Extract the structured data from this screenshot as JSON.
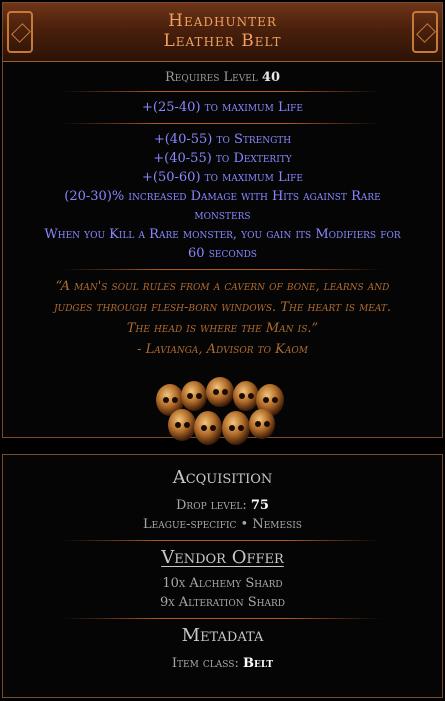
{
  "item": {
    "name_line1": "Headhunter",
    "name_line2": "Leather Belt",
    "requires_label": "Requires Level",
    "requires_value": "40",
    "implicit": "+(25-40) to maximum Life",
    "explicit": [
      "+(40-55) to Strength",
      "+(40-55) to Dexterity",
      "+(50-60) to maximum Life",
      "(20-30)% increased Damage with Hits against Rare",
      "monsters",
      "When you Kill a Rare monster, you gain its Modifiers for",
      "60 seconds"
    ],
    "flavour": [
      "“A man's soul rules from a cavern of bone, learns and",
      "judges through flesh-born windows. The heart is meat.",
      "The head is where the Man is.”",
      "- Lavianga, Advisor to Kaom"
    ],
    "image_icon": "skull-belt-icon"
  },
  "acquisition": {
    "title": "Acquisition",
    "drop_level_label": "Drop level:",
    "drop_level_value": "75",
    "league": "League-specific • Nemesis"
  },
  "vendor": {
    "title": "Vendor Offer",
    "lines": [
      "10x Alchemy Shard",
      "9x Alteration Shard"
    ]
  },
  "metadata": {
    "title": "Metadata",
    "class_label": "Item class:",
    "class_value": "Belt"
  },
  "colors": {
    "unique_name": "#f0a060",
    "magic_mod": "#8888ff",
    "flavour": "#b06a30",
    "border": "#7a4a2a"
  }
}
